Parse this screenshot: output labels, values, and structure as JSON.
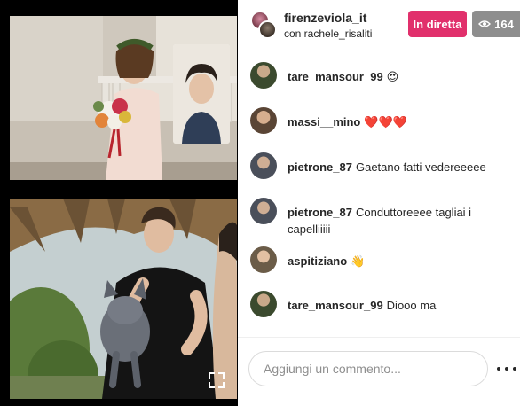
{
  "header": {
    "host_username": "firenzeviola_it",
    "with_label": "con rachele_risaliti",
    "live_label": "In diretta",
    "viewer_count": "164"
  },
  "comments": [
    {
      "user": "tare_mansour_99",
      "text": "😍",
      "avatar_color": "#3b4a2e"
    },
    {
      "user": "massi__mino",
      "text": "❤️❤️❤️",
      "avatar_color": "#5a4535"
    },
    {
      "user": "pietrone_87",
      "text": "Gaetano fatti vedereeeee",
      "avatar_color": "#4a4f5a"
    },
    {
      "user": "pietrone_87",
      "text": "Conduttoreeee tagliai i capelliiiii",
      "avatar_color": "#4a4f5a"
    },
    {
      "user": "aspitiziano",
      "text": "👋",
      "avatar_color": "#6b5c48"
    },
    {
      "user": "tare_mansour_99",
      "text": "Diooo ma",
      "avatar_color": "#3b4a2e"
    }
  ],
  "composer": {
    "placeholder": "Aggiungi un commento..."
  },
  "colors": {
    "live_badge": "#e1306c",
    "viewer_badge": "#8e8e8e"
  },
  "icons": {
    "viewers": "eye-icon",
    "more": "more-horizontal-icon",
    "expand": "expand-icon"
  }
}
